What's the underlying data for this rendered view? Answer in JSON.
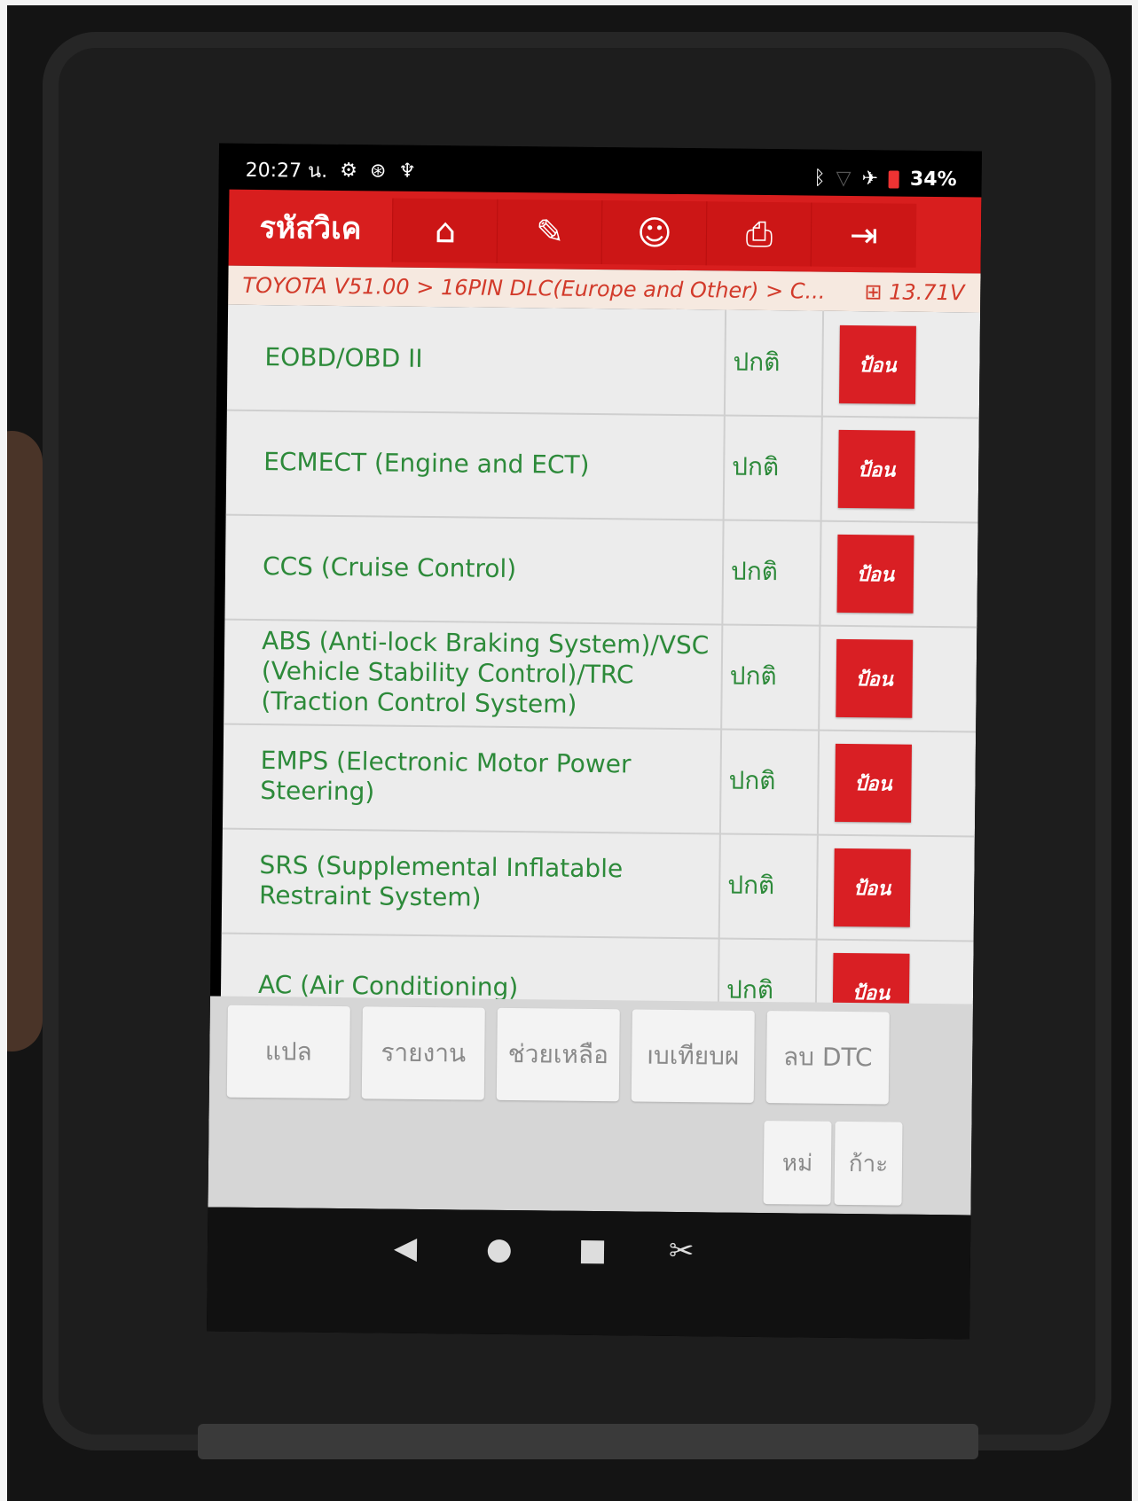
{
  "status_bar": {
    "time": "20:27 น.",
    "icons_left": [
      "gear-icon",
      "bluetooth-circle-icon",
      "stethoscope-icon"
    ],
    "icons_right": [
      "bluetooth-icon",
      "wifi-icon",
      "airplane-icon",
      "battery-icon"
    ],
    "battery": "34%"
  },
  "topbar": {
    "title": "รหัสวิเค",
    "buttons": [
      "home-icon",
      "edit-icon",
      "user-icon",
      "print-icon",
      "exit-icon"
    ]
  },
  "breadcrumb": {
    "path": "TOYOTA V51.00 > 16PIN DLC(Europe and Other) > C...",
    "voltage": "13.71V"
  },
  "systems": [
    {
      "name": "EOBD/OBD II",
      "status": "ปกติ",
      "action": "ป้อน"
    },
    {
      "name": "ECMECT (Engine and ECT)",
      "status": "ปกติ",
      "action": "ป้อน"
    },
    {
      "name": "CCS (Cruise Control)",
      "status": "ปกติ",
      "action": "ป้อน"
    },
    {
      "name": "ABS (Anti-lock Braking System)/VSC (Vehicle Stability Control)/TRC (Traction Control System)",
      "status": "ปกติ",
      "action": "ป้อน"
    },
    {
      "name": "EMPS (Electronic Motor Power Steering)",
      "status": "ปกติ",
      "action": "ป้อน"
    },
    {
      "name": "SRS (Supplemental Inflatable Restraint System)",
      "status": "ปกติ",
      "action": "ป้อน"
    },
    {
      "name": "AC (Air Conditioning)",
      "status": "ปกติ",
      "action": "ป้อน"
    }
  ],
  "function_buttons": [
    "แปล",
    "รายงาน",
    "ช่วยเหลือ",
    "ıบเทียบผ",
    "ลบ DTC"
  ],
  "small_buttons": [
    "หม่",
    "ก้าะ"
  ],
  "navbar": [
    "back-icon",
    "home-dot-icon",
    "recents-icon",
    "screenshot-icon"
  ]
}
